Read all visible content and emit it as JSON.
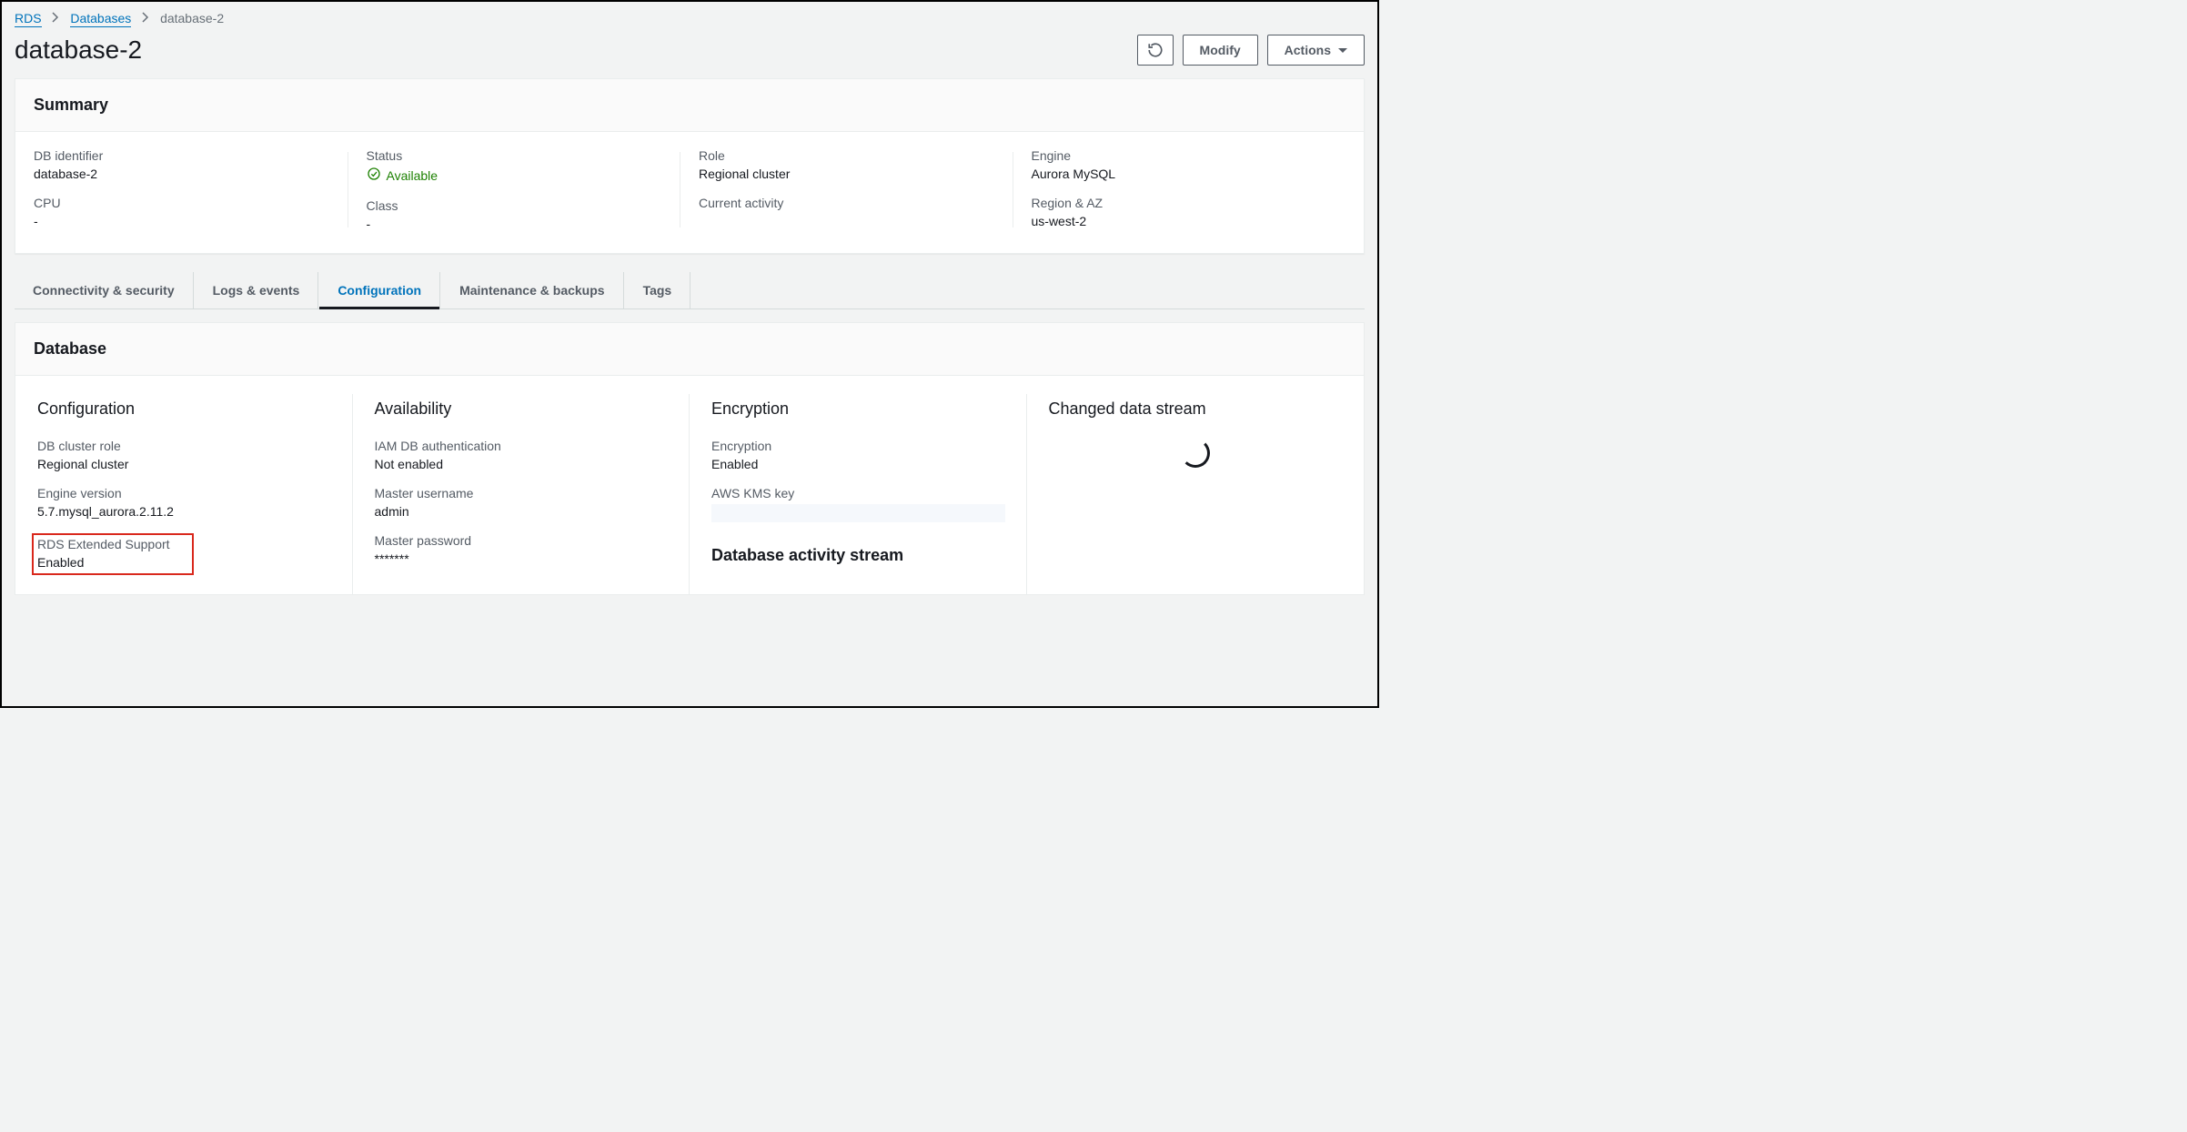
{
  "breadcrumb": {
    "root": "RDS",
    "databases": "Databases",
    "current": "database-2"
  },
  "header": {
    "title": "database-2",
    "modify_label": "Modify",
    "actions_label": "Actions"
  },
  "summary": {
    "title": "Summary",
    "db_identifier_label": "DB identifier",
    "db_identifier_value": "database-2",
    "cpu_label": "CPU",
    "cpu_value": "-",
    "status_label": "Status",
    "status_value": "Available",
    "class_label": "Class",
    "class_value": "-",
    "role_label": "Role",
    "role_value": "Regional cluster",
    "current_activity_label": "Current activity",
    "engine_label": "Engine",
    "engine_value": "Aurora MySQL",
    "region_az_label": "Region & AZ",
    "region_az_value": "us-west-2"
  },
  "tabs": {
    "connectivity": "Connectivity & security",
    "logs": "Logs & events",
    "configuration": "Configuration",
    "maintenance": "Maintenance & backups",
    "tags": "Tags"
  },
  "database": {
    "title": "Database",
    "configuration": {
      "heading": "Configuration",
      "db_cluster_role_label": "DB cluster role",
      "db_cluster_role_value": "Regional cluster",
      "engine_version_label": "Engine version",
      "engine_version_value": "5.7.mysql_aurora.2.11.2",
      "extended_support_label": "RDS Extended Support",
      "extended_support_value": "Enabled"
    },
    "availability": {
      "heading": "Availability",
      "iam_label": "IAM DB authentication",
      "iam_value": "Not enabled",
      "master_user_label": "Master username",
      "master_user_value": "admin",
      "master_pass_label": "Master password",
      "master_pass_value": "*******"
    },
    "encryption": {
      "heading": "Encryption",
      "encryption_label": "Encryption",
      "encryption_value": "Enabled",
      "kms_label": "AWS KMS key",
      "activity_heading": "Database activity stream"
    },
    "cds": {
      "heading": "Changed data stream"
    }
  }
}
